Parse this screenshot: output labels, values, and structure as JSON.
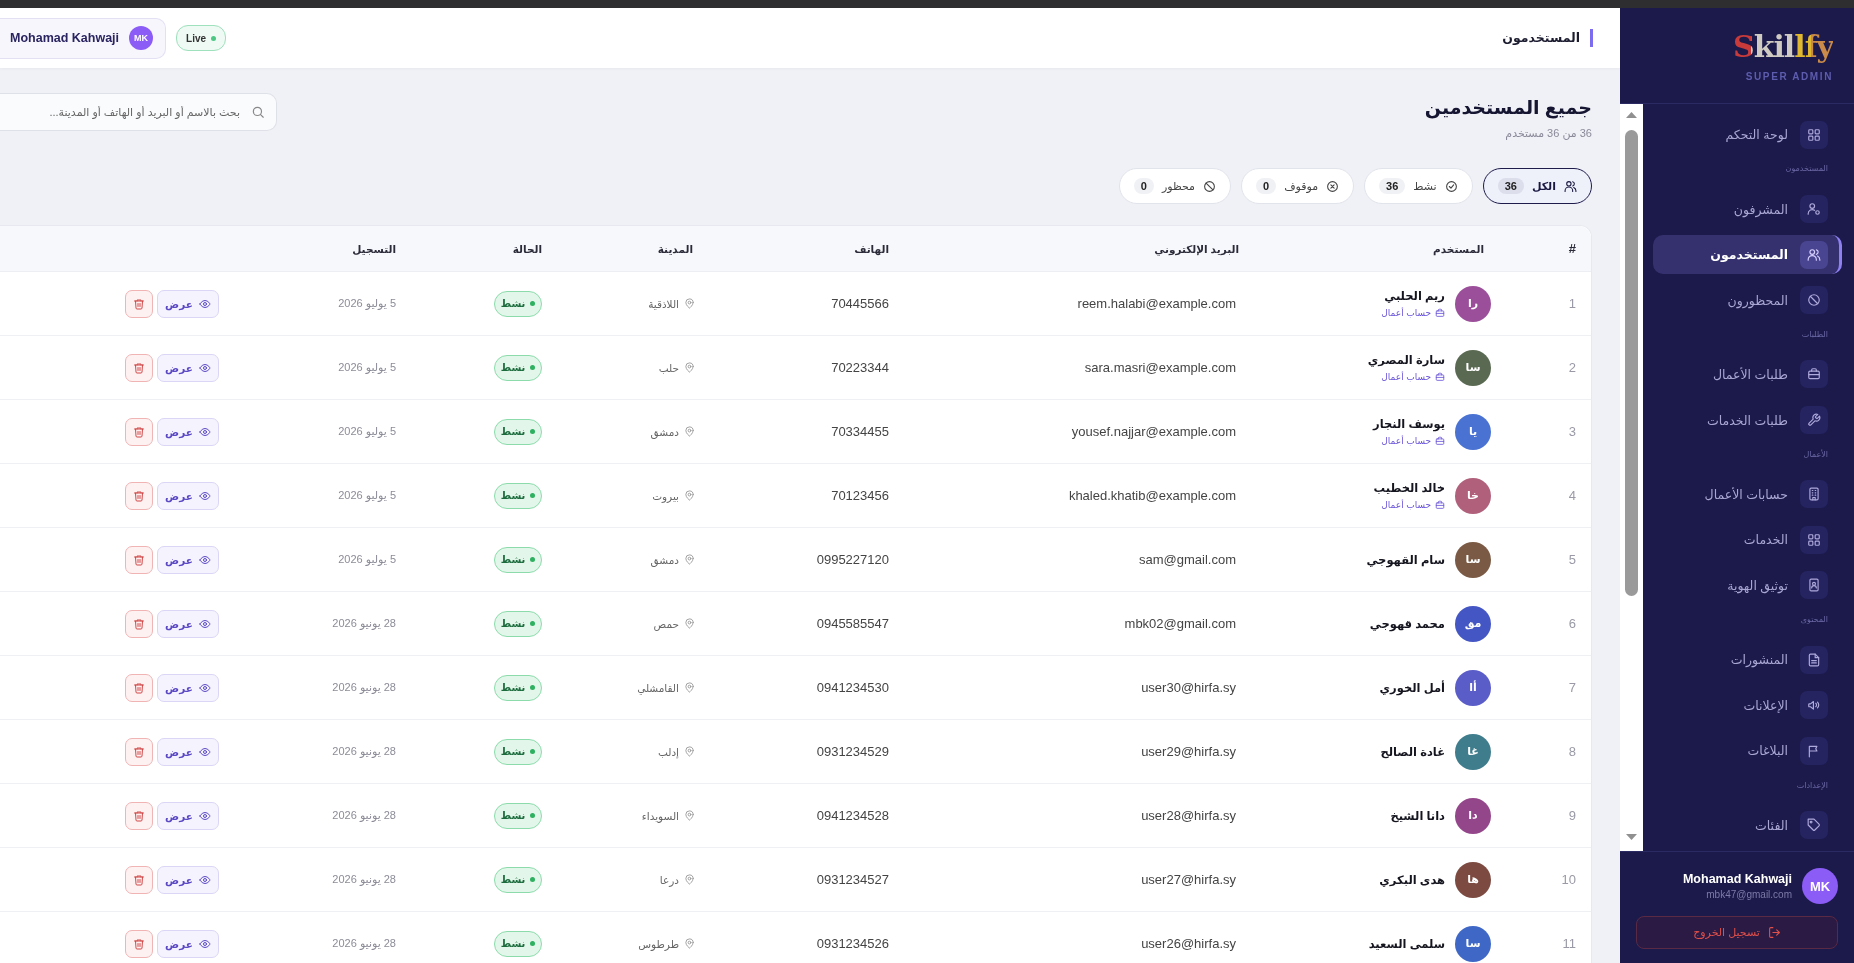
{
  "sidebar": {
    "logo": "Skillfy",
    "role": "SUPER ADMIN",
    "nav": [
      {
        "kind": "item",
        "label": "لوحة التحكم",
        "selected": false
      },
      {
        "kind": "section",
        "label": "المستخدمون"
      },
      {
        "kind": "item",
        "label": "المشرفون",
        "selected": false
      },
      {
        "kind": "item",
        "label": "المستخدمون",
        "selected": true
      },
      {
        "kind": "item",
        "label": "المحظورون",
        "selected": false
      },
      {
        "kind": "section",
        "label": "الطلبات"
      },
      {
        "kind": "item",
        "label": "طلبات الأعمال",
        "selected": false
      },
      {
        "kind": "item",
        "label": "طلبات الخدمات",
        "selected": false
      },
      {
        "kind": "section",
        "label": "الأعمال"
      },
      {
        "kind": "item",
        "label": "حسابات الأعمال",
        "selected": false
      },
      {
        "kind": "item",
        "label": "الخدمات",
        "selected": false
      },
      {
        "kind": "item",
        "label": "توثيق الهوية",
        "selected": false
      },
      {
        "kind": "section",
        "label": "المحتوى"
      },
      {
        "kind": "item",
        "label": "المنشورات",
        "selected": false
      },
      {
        "kind": "item",
        "label": "الإعلانات",
        "selected": false
      },
      {
        "kind": "item",
        "label": "البلاغات",
        "selected": false
      },
      {
        "kind": "section",
        "label": "الإعدادات"
      },
      {
        "kind": "item",
        "label": "الفئات",
        "selected": false
      }
    ],
    "user": {
      "name": "Mohamad Kahwaji",
      "email": "mbk47@gmail.com",
      "initials": "MK"
    },
    "logout": "تسجيل الخروج"
  },
  "topbar": {
    "title": "المستخدمون",
    "user": {
      "name": "Mohamad Kahwaji",
      "initials": "MK"
    },
    "live": "Live"
  },
  "page": {
    "title": "جميع المستخدمين",
    "subtitle": "36 من 36 مستخدم",
    "search": {
      "placeholder": "بحث بالاسم أو البريد أو الهاتف أو المدينة..."
    },
    "filters": [
      {
        "label": "الكل",
        "count": "36",
        "selected": true
      },
      {
        "label": "نشط",
        "count": "36",
        "selected": false
      },
      {
        "label": "موقوف",
        "count": "0",
        "selected": false
      },
      {
        "label": "محظور",
        "count": "0",
        "selected": false
      }
    ]
  },
  "table": {
    "columns": [
      "#",
      "المستخدم",
      "البريد الإلكتروني",
      "الهاتف",
      "المدينة",
      "الحالة",
      "التسجيل"
    ],
    "rows": [
      {
        "index": "1",
        "initials": "را",
        "color": "#9b4f9a",
        "name": "ريم الحلبي",
        "tag": "حساب أعمال",
        "email": "reem.halabi@example.com",
        "phone": "70445566",
        "city": "اللاذقية",
        "status": {
          "label": "نشط",
          "kind": "active"
        },
        "date": "5 يوليو 2026",
        "view": "عرض"
      },
      {
        "index": "2",
        "initials": "سا",
        "color": "#5a6a52",
        "name": "سارة المصري",
        "tag": "حساب أعمال",
        "email": "sara.masri@example.com",
        "phone": "70223344",
        "city": "حلب",
        "status": {
          "label": "نشط",
          "kind": "active"
        },
        "date": "5 يوليو 2026",
        "view": "عرض"
      },
      {
        "index": "3",
        "initials": "يا",
        "color": "#4a72d2",
        "name": "يوسف النجار",
        "tag": "حساب أعمال",
        "email": "yousef.najjar@example.com",
        "phone": "70334455",
        "city": "دمشق",
        "status": {
          "label": "نشط",
          "kind": "active"
        },
        "date": "5 يوليو 2026",
        "view": "عرض"
      },
      {
        "index": "4",
        "initials": "خا",
        "color": "#b0607a",
        "name": "خالد الخطيب",
        "tag": "حساب أعمال",
        "email": "khaled.khatib@example.com",
        "phone": "70123456",
        "city": "بيروت",
        "status": {
          "label": "نشط",
          "kind": "active"
        },
        "date": "5 يوليو 2026",
        "view": "عرض"
      },
      {
        "index": "5",
        "initials": "سا",
        "color": "#7a5a44",
        "name": "سام القهوجي",
        "email": "sam@gmail.com",
        "phone": "0995227120",
        "city": "دمشق",
        "status": {
          "label": "نشط",
          "kind": "active"
        },
        "date": "5 يوليو 2026",
        "view": "عرض"
      },
      {
        "index": "6",
        "initials": "مق",
        "color": "#4456c4",
        "name": "محمد قهوجي",
        "email": "mbk02@gmail.com",
        "phone": "0945585547",
        "city": "حمص",
        "status": {
          "label": "نشط",
          "kind": "active"
        },
        "date": "28 يونيو 2026",
        "view": "عرض"
      },
      {
        "index": "7",
        "initials": "أا",
        "color": "#5a5cc8",
        "name": "أمل الخوري",
        "email": "user30@hirfa.sy",
        "phone": "0941234530",
        "city": "القامشلي",
        "status": {
          "label": "نشط",
          "kind": "active"
        },
        "date": "28 يونيو 2026",
        "view": "عرض"
      },
      {
        "index": "8",
        "initials": "غا",
        "color": "#3f7c8c",
        "name": "غادة الصالح",
        "email": "user29@hirfa.sy",
        "phone": "0931234529",
        "city": "إدلب",
        "status": {
          "label": "نشط",
          "kind": "active"
        },
        "date": "28 يونيو 2026",
        "view": "عرض"
      },
      {
        "index": "9",
        "initials": "دا",
        "color": "#94468a",
        "name": "دانا الشيخ",
        "email": "user28@hirfa.sy",
        "phone": "0941234528",
        "city": "السويداء",
        "status": {
          "label": "نشط",
          "kind": "active"
        },
        "date": "28 يونيو 2026",
        "view": "عرض"
      },
      {
        "index": "10",
        "initials": "ها",
        "color": "#7c4a40",
        "name": "هدى البكري",
        "email": "user27@hirfa.sy",
        "phone": "0931234527",
        "city": "درعا",
        "status": {
          "label": "نشط",
          "kind": "active"
        },
        "date": "28 يونيو 2026",
        "view": "عرض"
      },
      {
        "index": "11",
        "initials": "سا",
        "color": "#3f68c6",
        "name": "سلمى السعيد",
        "email": "user26@hirfa.sy",
        "phone": "0931234526",
        "city": "طرطوس",
        "status": {
          "label": "نشط",
          "kind": "active"
        },
        "date": "28 يونيو 2026",
        "view": "عرض"
      }
    ]
  }
}
